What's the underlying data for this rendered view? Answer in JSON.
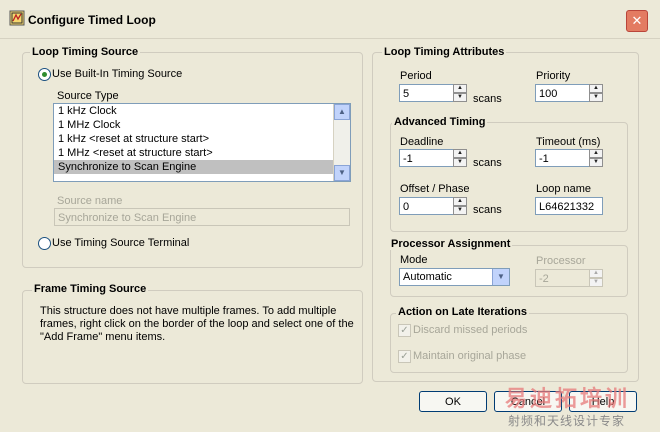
{
  "window": {
    "title": "Configure Timed Loop",
    "close_icon": "close-x"
  },
  "loop_timing_source": {
    "title": "Loop Timing Source",
    "use_builtin_label": "Use Built-In Timing Source",
    "use_builtin_selected": true,
    "source_type_label": "Source Type",
    "source_types": [
      "1 kHz Clock",
      "1 MHz Clock",
      "1 kHz <reset at structure start>",
      "1 MHz <reset at structure start>",
      "Synchronize to Scan Engine"
    ],
    "selected_index": 4,
    "source_name_label": "Source name",
    "source_name_value": "Synchronize to Scan Engine",
    "use_terminal_label": "Use Timing Source Terminal",
    "use_terminal_selected": false
  },
  "frame_timing_source": {
    "title": "Frame Timing Source",
    "text": "This structure does not have multiple frames. To add multiple frames, right click on the border of the loop and select one of the \"Add Frame\" menu items.",
    "line1": "This structure does not have multiple frames. To add multiple",
    "line2": "frames, right click on the border of the loop and select one of the",
    "line3": "\"Add Frame\" menu items."
  },
  "loop_timing_attributes": {
    "title": "Loop Timing Attributes",
    "period_label": "Period",
    "period_value": "5",
    "period_unit": "scans",
    "priority_label": "Priority",
    "priority_value": "100"
  },
  "advanced_timing": {
    "title": "Advanced Timing",
    "deadline_label": "Deadline",
    "deadline_value": "-1",
    "deadline_unit": "scans",
    "timeout_label": "Timeout (ms)",
    "timeout_value": "-1",
    "offset_label": "Offset / Phase",
    "offset_value": "0",
    "offset_unit": "scans",
    "loop_name_label": "Loop name",
    "loop_name_value": "L64621332"
  },
  "processor_assignment": {
    "title": "Processor Assignment",
    "mode_label": "Mode",
    "mode_value": "Automatic",
    "processor_label": "Processor",
    "processor_value": "-2"
  },
  "late_iterations": {
    "title": "Action on Late Iterations",
    "discard_label": "Discard missed periods",
    "discard_checked": true,
    "maintain_label": "Maintain original phase",
    "maintain_checked": true
  },
  "buttons": {
    "ok": "OK",
    "cancel": "Cancel",
    "help": "Help"
  },
  "watermark": {
    "line1": "易迪拓培训",
    "line2": "射频和天线设计专家"
  }
}
